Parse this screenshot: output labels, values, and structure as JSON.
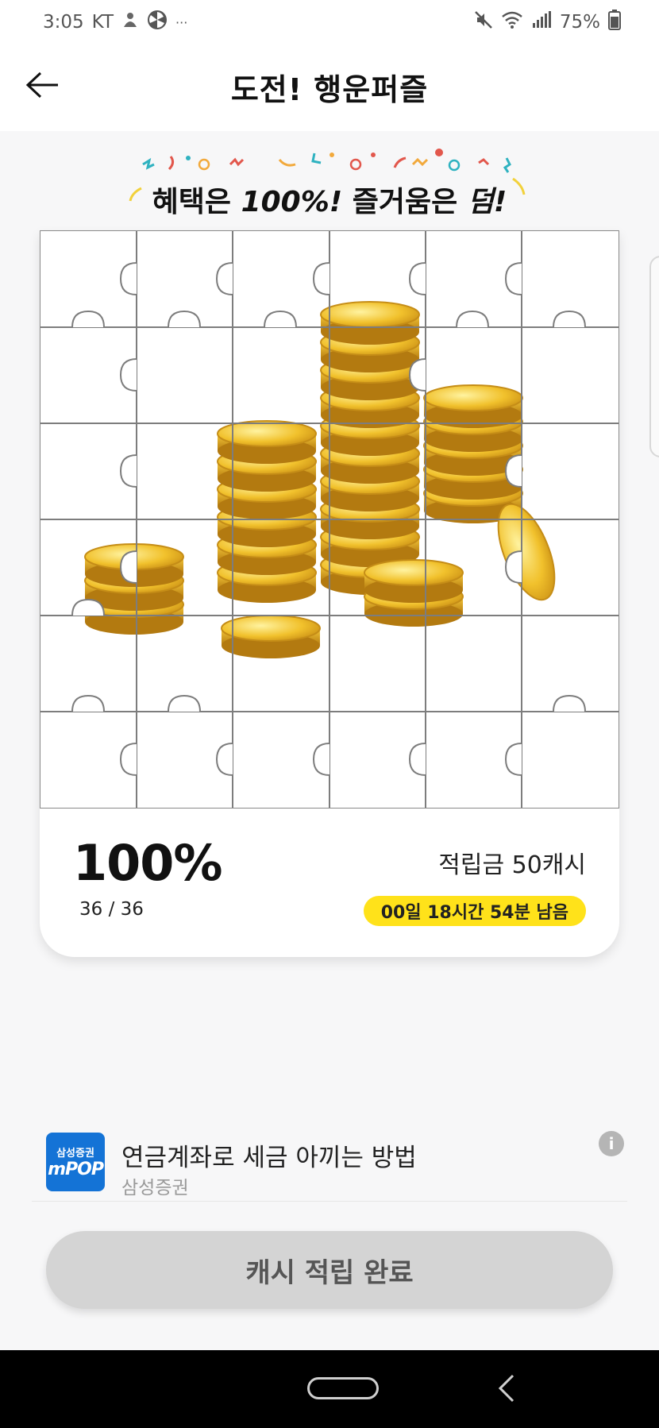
{
  "status_bar": {
    "time": "3:05",
    "carrier": "KT",
    "overflow": "···",
    "battery": "75%",
    "icons": [
      "notification-icon",
      "fan-icon",
      "mute-icon",
      "wifi-icon",
      "signal-icon",
      "battery-icon"
    ]
  },
  "header": {
    "title": "도전! 행운퍼즐",
    "back_icon": "arrow-left-icon"
  },
  "banner": {
    "text_part1": "혜택은 ",
    "text_em1": "100%!",
    "text_part2": " 즐거움은 ",
    "text_em2": "덤!"
  },
  "puzzle": {
    "rows": 6,
    "cols": 6,
    "image": "gold-coins-image"
  },
  "progress": {
    "percent_label": "100%",
    "count_label": "36 / 36",
    "percent": 100,
    "pieces_done": 36,
    "pieces_total": 36
  },
  "reward": {
    "text": "적립금 50캐시",
    "time_left": "00일 18시간 54분 남음"
  },
  "ad": {
    "logo_line1": "삼성증권",
    "logo_line2": "mPOP",
    "title": "연금계좌로 세금 아끼는 방법",
    "sponsor": "삼성증권",
    "info_label": "i"
  },
  "complete_button": {
    "label": "캐시 적립 완료"
  },
  "colors": {
    "accent_yellow": "#ffe21a",
    "coin_gold": "#e9b31e",
    "ad_blue": "#1473d6",
    "button_disabled": "#d4d4d4"
  }
}
